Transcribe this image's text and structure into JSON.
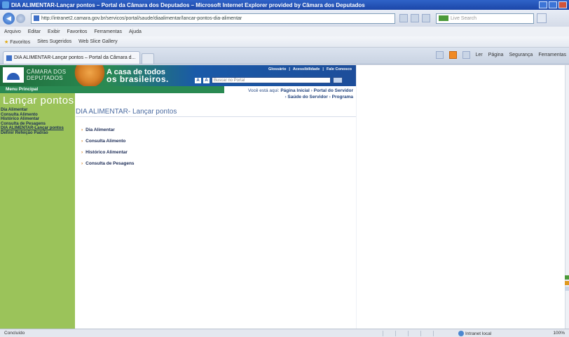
{
  "window": {
    "title": "DIA ALIMENTAR-Lançar pontos – Portal da Câmara dos Deputados – Microsoft Internet Explorer provided by Câmara dos Deputados"
  },
  "address": {
    "url": "http://intranet2.camara.gov.br/servicos/portal/saude/diaalimentar/lancar-pontos-dia-alimentar",
    "search_placeholder": "Live Search"
  },
  "menubar": [
    "Arquivo",
    "Editar",
    "Exibir",
    "Favoritos",
    "Ferramentas",
    "Ajuda"
  ],
  "favorites": {
    "label": "Favoritos",
    "items": [
      "Sites Sugeridos",
      "Web Slice Gallery"
    ]
  },
  "tab": {
    "label": "DIA ALIMENTAR-Lançar pontos – Portal da Câmara d..."
  },
  "commandbar": [
    "Ler",
    "Página",
    "Segurança",
    "Ferramentas"
  ],
  "portal": {
    "logo_text_1": "CÂMARA DOS",
    "logo_text_2": "DEPUTADOS",
    "tagline_1": "A casa de todos",
    "tagline_2": "os brasileiros.",
    "topnav": [
      "Glossário",
      "Acessibilidade",
      "Fale Conosco"
    ],
    "font_a_small": "A",
    "font_a_big": "A",
    "search_placeholder": "Buscar no Portal",
    "menu_principal": "Menu Principal",
    "breadcrumb_prefix": "Você está aqui:",
    "breadcrumb_1": "Página Inicial",
    "breadcrumb_2": "Portal do Servidor",
    "breadcrumb_3": "Saúde do Servidor",
    "breadcrumb_4": "Programa",
    "section_title": "Lançar pontos",
    "side_links": [
      "Dia Alimentar",
      "Consulta Alimento",
      "Histórico Alimentar",
      "Consulta de Pesagens",
      "DIA ALIMENTAR-Lançar pontos",
      "Definir Refeição Padrão"
    ],
    "page_title": "DIA ALIMENTAR- Lançar pontos",
    "menu_items": [
      "Dia Alimentar",
      "Consulta Alimento",
      "Histórico Alimentar",
      "Consulta de Pesagens"
    ]
  },
  "statusbar": {
    "text": "Concluído",
    "zone": "Intranet local",
    "zoom": "100%"
  }
}
